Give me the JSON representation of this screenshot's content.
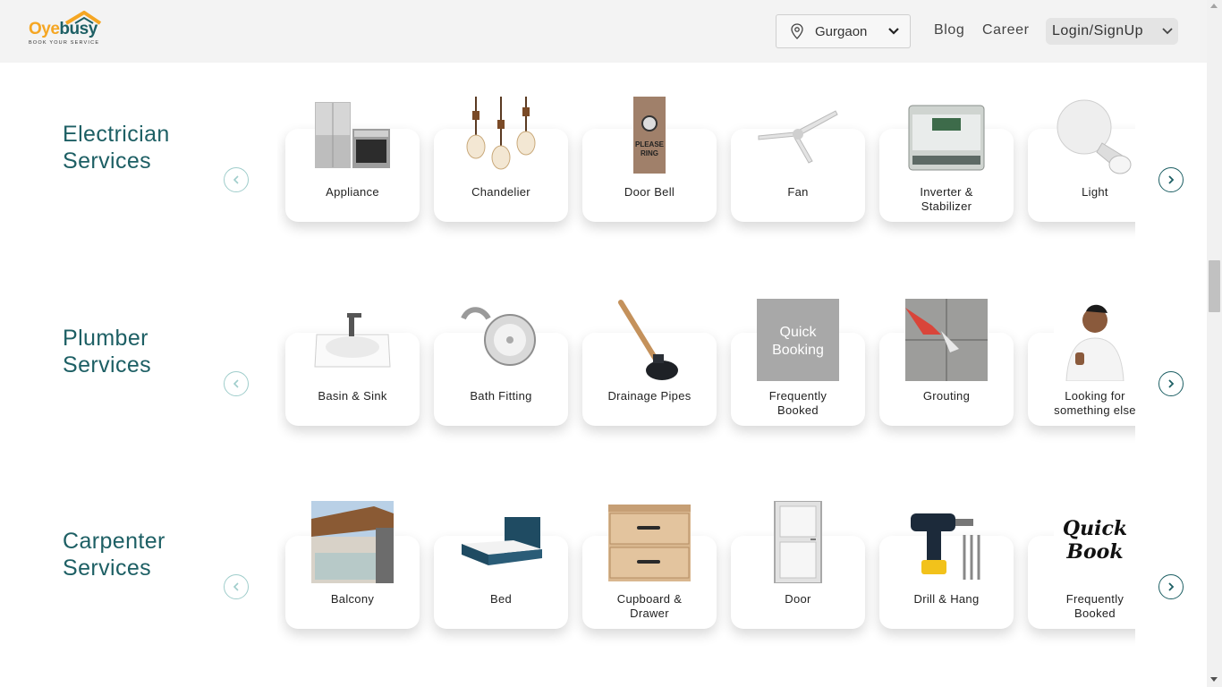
{
  "brand": {
    "logo_oye": "Oye",
    "logo_busy": "busy",
    "tagline": "BOOK YOUR SERVICE"
  },
  "header": {
    "location": "Gurgaon",
    "nav": [
      "Blog",
      "Career"
    ],
    "login_label": "Login/SignUp"
  },
  "sections": [
    {
      "title_line1": "Electrician",
      "title_line2": "Services",
      "items": [
        {
          "label": "Appliance",
          "icon": "fridge-oven-icon"
        },
        {
          "label": "Chandelier",
          "icon": "chandelier-icon"
        },
        {
          "label": "Door Bell",
          "icon": "door-bell-icon"
        },
        {
          "label": "Fan",
          "icon": "ceiling-fan-icon"
        },
        {
          "label": "Inverter &",
          "label2": "Stabilizer",
          "icon": "stabilizer-icon"
        },
        {
          "label": "Light",
          "icon": "light-bulb-icon"
        }
      ]
    },
    {
      "title_line1": "Plumber",
      "title_line2": "Services",
      "items": [
        {
          "label": "Basin & Sink",
          "icon": "basin-sink-icon"
        },
        {
          "label": "Bath Fitting",
          "icon": "shower-head-icon"
        },
        {
          "label": "Drainage Pipes",
          "icon": "plunger-icon"
        },
        {
          "label": "Frequently",
          "label2": "Booked",
          "icon": "quick-booking-icon",
          "img_text1": "Quick",
          "img_text2": "Booking"
        },
        {
          "label": "Grouting",
          "icon": "grouting-icon"
        },
        {
          "label": "Looking for",
          "label2": "something else",
          "icon": "person-thumbs-up-icon"
        }
      ]
    },
    {
      "title_line1": "Carpenter",
      "title_line2": "Services",
      "items": [
        {
          "label": "Balcony",
          "icon": "balcony-icon"
        },
        {
          "label": "Bed",
          "icon": "bed-icon"
        },
        {
          "label": "Cupboard &",
          "label2": "Drawer",
          "icon": "drawer-icon"
        },
        {
          "label": "Door",
          "icon": "door-icon"
        },
        {
          "label": "Drill & Hang",
          "icon": "drill-icon"
        },
        {
          "label": "Frequently",
          "label2": "Booked",
          "icon": "quick-book-icon",
          "img_text1": "Quick",
          "img_text2": "Book"
        }
      ]
    }
  ],
  "colors": {
    "accent": "#1d5f64",
    "brand_orange": "#f5a623",
    "header_bg": "#f3f3f3"
  }
}
